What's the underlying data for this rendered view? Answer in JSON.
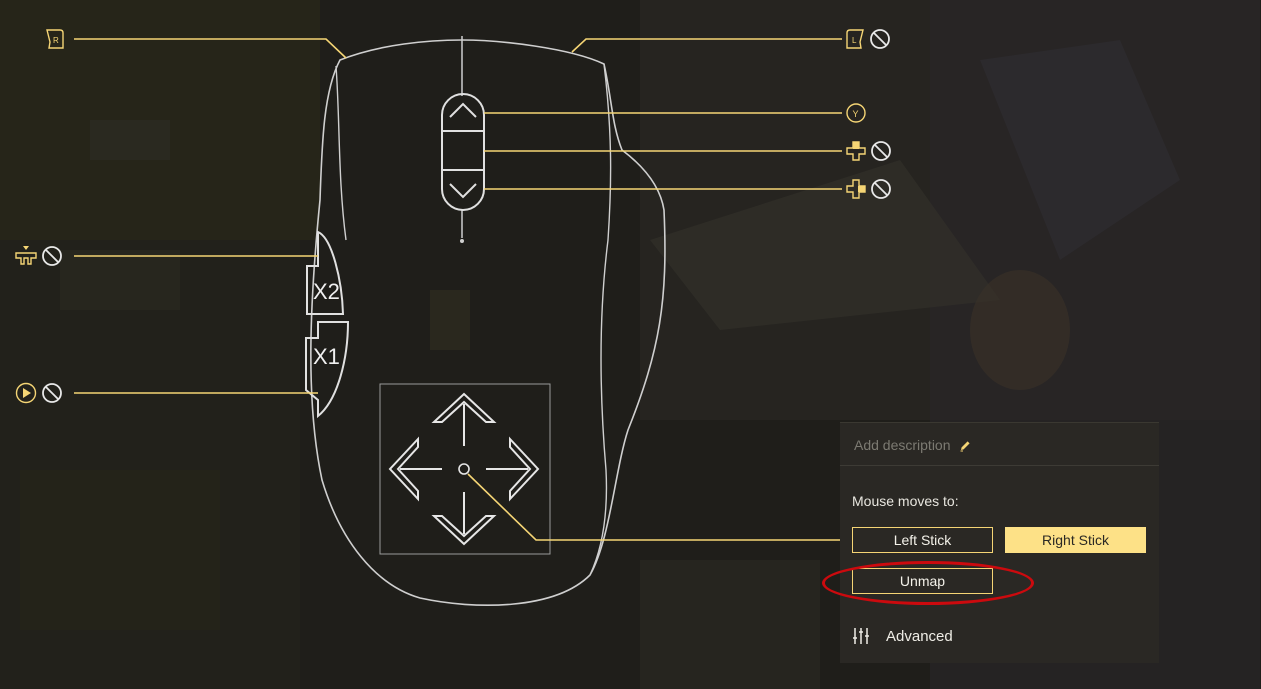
{
  "panel": {
    "description_placeholder": "Add description",
    "mouse_moves_label": "Mouse moves to:",
    "left_stick_label": "Left Stick",
    "right_stick_label": "Right Stick",
    "selected": "Right Stick",
    "unmap_label": "Unmap",
    "advanced_label": "Advanced"
  },
  "mouse_labels": {
    "x2": "X2",
    "x1": "X1"
  },
  "mappings": {
    "right_button": {
      "glyph": "R",
      "icon": "right-bumper-icon",
      "unmapped": false
    },
    "left_button": {
      "glyph": "L",
      "icon": "left-bumper-icon",
      "unmapped": true
    },
    "wheel_up": {
      "glyph": "Y",
      "icon": "y-button-icon",
      "unmapped": false
    },
    "wheel_click": {
      "icon": "dpad-up-icon",
      "unmapped": true
    },
    "wheel_down": {
      "icon": "dpad-right-icon",
      "unmapped": true
    },
    "x2_button": {
      "icon": "share-icon",
      "unmapped": true
    },
    "x1_button": {
      "icon": "start-icon",
      "unmapped": true
    }
  },
  "colors": {
    "accent": "#f5d575",
    "selected_fill": "#fde187",
    "highlight": "#cc0a0e",
    "outline": "#cfcfcf",
    "panel_bg": "#2a2824"
  }
}
